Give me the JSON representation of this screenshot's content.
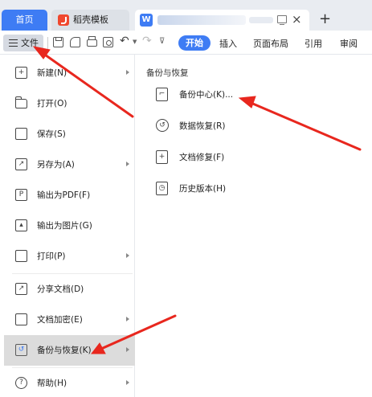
{
  "tabs": {
    "home": "首页",
    "template": "稻壳模板",
    "doc_logo": "W",
    "new_tab": "+",
    "close": "×"
  },
  "toolbar": {
    "file_label": "文件",
    "undo_icon": "↶",
    "redo_icon": "↷",
    "customize_icon": "⊽",
    "ribbon_tabs": [
      "开始",
      "插入",
      "页面布局",
      "引用",
      "审阅"
    ]
  },
  "file_menu": {
    "items": [
      {
        "label": "新建(N)",
        "icon": "new-icon",
        "glyph": "+",
        "submenu": true
      },
      {
        "label": "打开(O)",
        "icon": "folder-icon",
        "glyph": "",
        "submenu": false
      },
      {
        "label": "保存(S)",
        "icon": "save-icon",
        "glyph": "",
        "submenu": false
      },
      {
        "label": "另存为(A)",
        "icon": "save-as-icon",
        "glyph": "↗",
        "submenu": true
      },
      {
        "label": "输出为PDF(F)",
        "icon": "pdf-icon",
        "glyph": "P",
        "submenu": false
      },
      {
        "label": "输出为图片(G)",
        "icon": "image-icon",
        "glyph": "▴",
        "submenu": false
      },
      {
        "label": "打印(P)",
        "icon": "print-icon",
        "glyph": "",
        "submenu": true
      },
      {
        "label": "分享文档(D)",
        "icon": "share-icon",
        "glyph": "↗",
        "submenu": false
      },
      {
        "label": "文档加密(E)",
        "icon": "lock-icon",
        "glyph": "",
        "submenu": true
      },
      {
        "label": "备份与恢复(K)",
        "icon": "backup-icon",
        "glyph": "↺",
        "submenu": true,
        "active": true
      },
      {
        "label": "帮助(H)",
        "icon": "help-icon",
        "glyph": "?",
        "submenu": true
      }
    ]
  },
  "submenu": {
    "header": "备份与恢复",
    "items": [
      {
        "label": "备份中心(K)...",
        "icon": "backup-center-icon",
        "glyph": "⌐"
      },
      {
        "label": "数据恢复(R)",
        "icon": "data-restore-icon",
        "glyph": "↺"
      },
      {
        "label": "文档修复(F)",
        "icon": "document-repair-icon",
        "glyph": "+"
      },
      {
        "label": "历史版本(H)",
        "icon": "history-version-icon",
        "glyph": "◷"
      }
    ]
  },
  "colors": {
    "accent": "#3e7cf4",
    "annotation_arrow": "#e8271e",
    "active_item_bg": "#dcdcdc"
  }
}
